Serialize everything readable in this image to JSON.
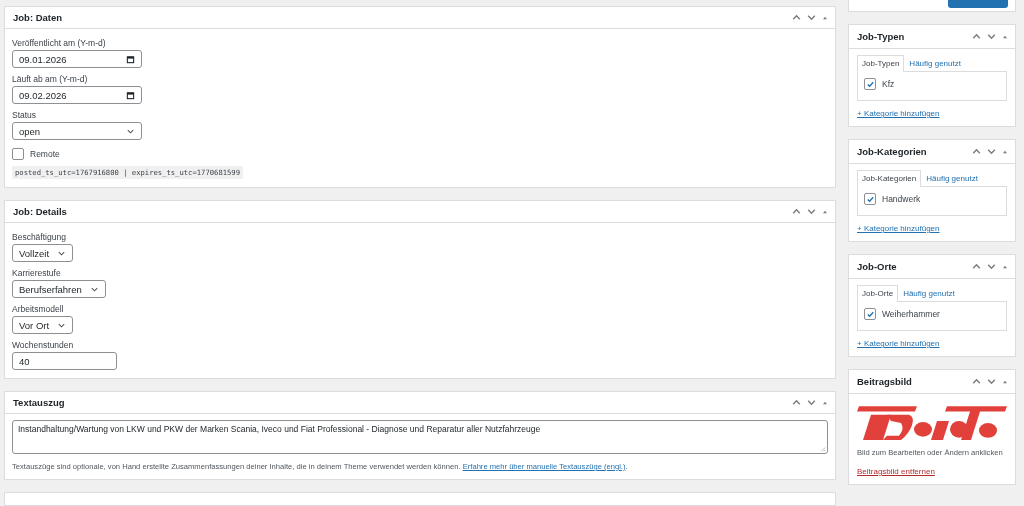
{
  "job_daten": {
    "title": "Job: Daten",
    "published": {
      "label": "Veröffentlicht am (Y-m-d)",
      "value": "09.01.2026"
    },
    "expires": {
      "label": "Läuft ab am (Y-m-d)",
      "value": "09.02.2026"
    },
    "status": {
      "label": "Status",
      "value": "open"
    },
    "remote": {
      "label": "Remote",
      "checked": false
    },
    "timestamps": "posted_ts_utc=1767916800 | expires_ts_utc=1770681599"
  },
  "job_details": {
    "title": "Job: Details",
    "fields": [
      {
        "kind": "select",
        "label": "Beschäftigung",
        "value": "Vollzeit"
      },
      {
        "kind": "select",
        "label": "Karrierestufe",
        "value": "Berufserfahren"
      },
      {
        "kind": "select",
        "label": "Arbeitsmodell",
        "value": "Vor Ort"
      },
      {
        "kind": "input",
        "label": "Wochenstunden",
        "value": "40"
      }
    ]
  },
  "excerpt": {
    "title": "Textauszug",
    "value": "Instandhaltung/Wartung von LKW und PKW der Marken Scania, Iveco und Fiat Professional - Diagnose und Reparatur aller Nutzfahrzeuge",
    "help": "Textauszüge sind optionale, von Hand erstellte Zusammenfassungen deiner Inhalte, die in deinem Theme verwendet werden können.",
    "link": "Erfahre mehr über manuelle Textauszüge (engl.)",
    "after_link": "."
  },
  "sidebar": {
    "taxonomies": [
      {
        "title": "Job-Typen",
        "tabs": [
          {
            "label": "Job-Typen",
            "selected": true
          },
          {
            "label": "Häufig genutzt",
            "selected": false
          }
        ],
        "terms": [
          {
            "label": "Kfz",
            "checked": true
          }
        ],
        "add_link": "+ Kategorie hinzufügen"
      },
      {
        "title": "Job-Kategorien",
        "tabs": [
          {
            "label": "Job-Kategorien",
            "selected": true
          },
          {
            "label": "Häufig genutzt",
            "selected": false
          }
        ],
        "terms": [
          {
            "label": "Handwerk",
            "checked": true
          }
        ],
        "add_link": "+ Kategorie hinzufügen"
      },
      {
        "title": "Job-Orte",
        "tabs": [
          {
            "label": "Job-Orte",
            "selected": true
          },
          {
            "label": "Häufig genutzt",
            "selected": false
          }
        ],
        "terms": [
          {
            "label": "Weiherhammer",
            "checked": true
          }
        ],
        "add_link": "+ Kategorie hinzufügen"
      }
    ],
    "featured_image": {
      "title": "Beitragsbild",
      "hint": "Bild zum Bearbeiten oder Ändern anklicken",
      "remove_link": "Beitragsbild entfernen"
    }
  }
}
